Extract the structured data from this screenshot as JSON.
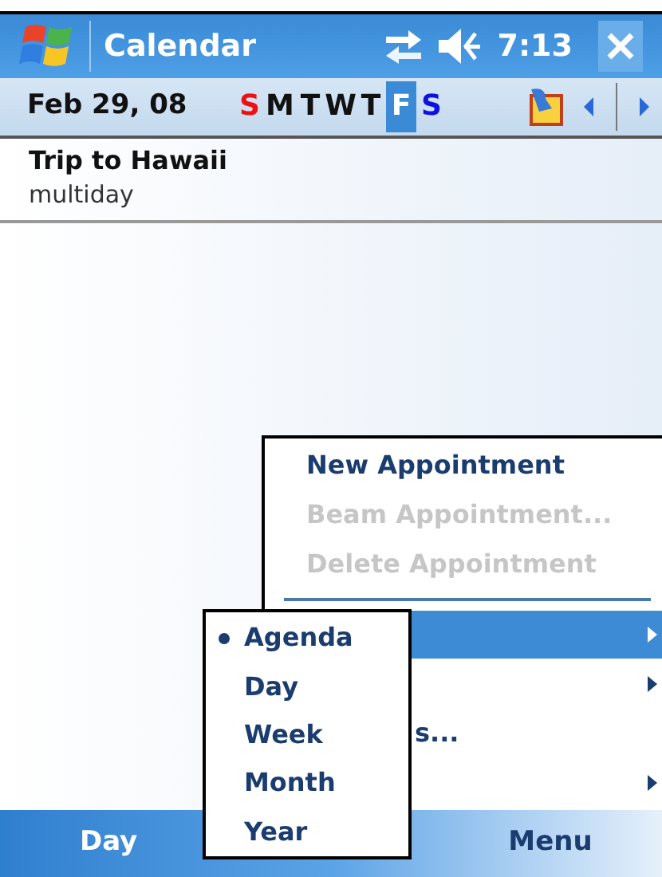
{
  "title_bar": {
    "title": "Calendar",
    "time": "7:13"
  },
  "toolbar": {
    "date": "Feb 29, 08",
    "days": [
      {
        "label": "S",
        "selected": false,
        "color": "#ee1111"
      },
      {
        "label": "M",
        "selected": false,
        "color": "#111111"
      },
      {
        "label": "T",
        "selected": false,
        "color": "#111111"
      },
      {
        "label": "W",
        "selected": false,
        "color": "#111111"
      },
      {
        "label": "T",
        "selected": false,
        "color": "#111111"
      },
      {
        "label": "F",
        "selected": true,
        "color": "#ffffff"
      },
      {
        "label": "S",
        "selected": false,
        "color": "#1111dd"
      }
    ]
  },
  "appointments": [
    {
      "title": "Trip to Hawaii",
      "subtitle": "multiday"
    }
  ],
  "soft_keys": {
    "left": "Day",
    "right": "Menu"
  },
  "menu": {
    "items": [
      {
        "kind": "item",
        "label": "New Appointment",
        "disabled": false,
        "highlighted": false,
        "submenu": false
      },
      {
        "kind": "item",
        "label": "Beam Appointment...",
        "disabled": true,
        "highlighted": false,
        "submenu": false
      },
      {
        "kind": "item",
        "label": "Delete Appointment",
        "disabled": true,
        "highlighted": false,
        "submenu": false
      },
      {
        "kind": "separator"
      },
      {
        "kind": "item",
        "disabled": false,
        "highlighted": true,
        "submenu": true
      },
      {
        "kind": "item",
        "disabled": false,
        "highlighted": false,
        "submenu": true
      },
      {
        "kind": "covered_item",
        "label": "s...",
        "disabled": false,
        "highlighted": false,
        "submenu": false
      },
      {
        "kind": "item",
        "disabled": false,
        "highlighted": false,
        "submenu": true
      }
    ]
  },
  "submenu": {
    "items": [
      {
        "label": "Agenda",
        "selected": true
      },
      {
        "label": "Day",
        "selected": false
      },
      {
        "label": "Week",
        "selected": false
      },
      {
        "label": "Month",
        "selected": false
      },
      {
        "label": "Year",
        "selected": false
      }
    ]
  }
}
